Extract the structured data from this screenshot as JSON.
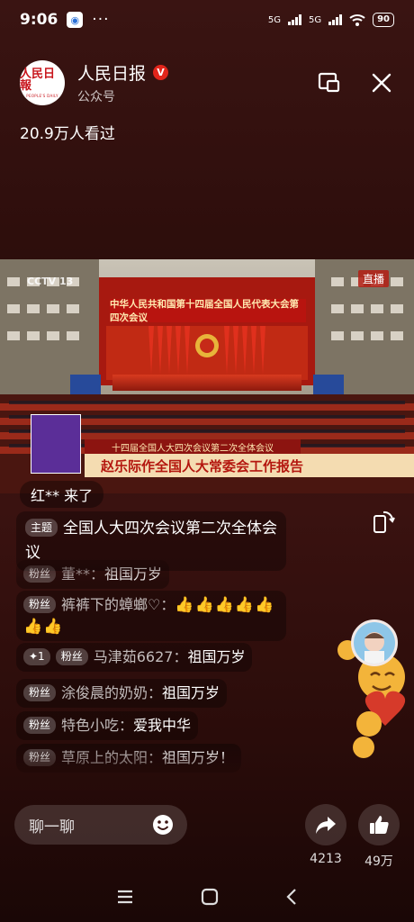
{
  "status_bar": {
    "time": "9:06",
    "dots": "···",
    "network": "5G",
    "network2": "5G",
    "battery": "90"
  },
  "header": {
    "logo_text": "人民日報",
    "logo_subtext": "PEOPLE'S DAILY",
    "account_name": "人民日报",
    "verified_mark": "V",
    "account_type": "公众号"
  },
  "view_count": "20.9万人看过",
  "video": {
    "cctv": "CCTV 13",
    "live_badge": "直播",
    "banner_title": "中华人民共和国第十四届全国人民代表大会第四次会议",
    "caption_top": "十四届全国人大四次会议第二次全体会议",
    "caption_main": "赵乐际作全国人大常委会工作报告"
  },
  "chat": {
    "join_message": "红** 来了",
    "topic_tag": "主题",
    "topic_text": "全国人大四次会议第二次全体会议",
    "messages": [
      {
        "tag": "粉丝",
        "user": "董**：",
        "text": "祖国万岁"
      },
      {
        "tag": "粉丝",
        "user": "裤裤下的蟑螂♡：",
        "text": "👍👍👍👍👍👍👍"
      },
      {
        "tag_extra": "✦1",
        "tag": "粉丝",
        "user": "马津茹6627：",
        "text": "祖国万岁"
      },
      {
        "tag": "粉丝",
        "user": "涂俊晨的奶奶：",
        "text": "祖国万岁"
      },
      {
        "tag": "粉丝",
        "user": "特色小吃：",
        "text": "爱我中华"
      },
      {
        "tag": "粉丝",
        "user": "草原上的太阳：",
        "text": "祖国万岁！"
      }
    ]
  },
  "bottom": {
    "comment_placeholder": "聊一聊",
    "share_count": "4213",
    "like_count": "49万"
  },
  "colors": {
    "brand_red": "#c8161d",
    "background_dark": "#2c0d0b"
  }
}
